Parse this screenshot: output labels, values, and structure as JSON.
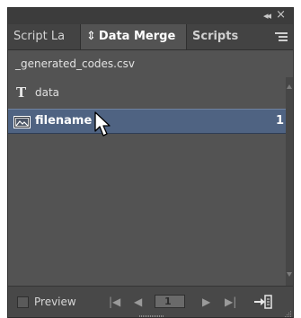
{
  "titlebar": {
    "collapse_glyph": "◂◂",
    "close_glyph": "×"
  },
  "tabs": [
    {
      "label": "Script La"
    },
    {
      "arrows": "⇕",
      "label": "Data Merge"
    },
    {
      "label": "Scripts"
    }
  ],
  "source_file": "_generated_codes.csv",
  "fields": [
    {
      "type_glyph": "T",
      "label": "data",
      "icon": "text-field-icon"
    },
    {
      "label": "filename",
      "icon": "image-field-icon",
      "count": "1",
      "selected": true
    }
  ],
  "footer": {
    "preview_label": "Preview",
    "first_glyph": "|◀",
    "prev_glyph": "◀",
    "page_value": "1",
    "next_glyph": "▶",
    "last_glyph": "▶|"
  },
  "colors": {
    "panel_bg": "#535353",
    "selection_bg": "#4f6382",
    "tab_bar_bg": "#434343"
  }
}
